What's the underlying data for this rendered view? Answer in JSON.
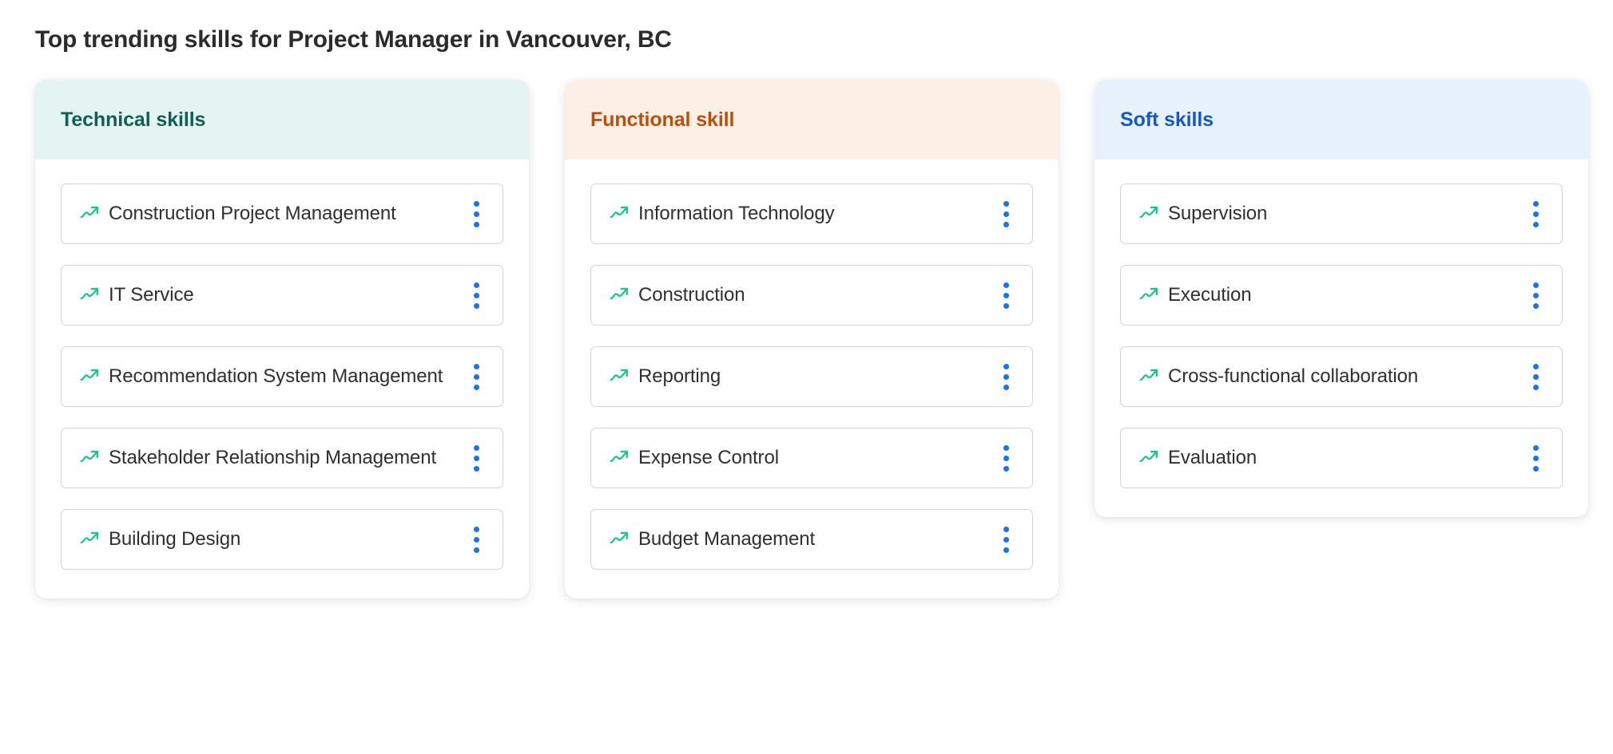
{
  "page": {
    "title": "Top trending skills for Project Manager in Vancouver, BC",
    "background": "#ffffff"
  },
  "icons": {
    "trend": "trending-up-icon",
    "menu": "kebab-menu-icon"
  },
  "colors": {
    "trend_icon": "#1ec28b",
    "kebab_dot": "#1a73e8",
    "item_border": "#d4d4d8",
    "item_text": "#2f2f2f",
    "title_text": "#2b2b2b"
  },
  "columns": [
    {
      "id": "technical-skills",
      "header": "Technical skills",
      "header_bg": "#e4f4f0",
      "header_color": "#0f5f58",
      "items": [
        {
          "label": "Construction Project Management"
        },
        {
          "label": "IT Service"
        },
        {
          "label": "Recommendation System Management"
        },
        {
          "label": "Stakeholder Relationship Management"
        },
        {
          "label": "Building Design"
        }
      ]
    },
    {
      "id": "functional-skill",
      "header": "Functional skill",
      "header_bg": "#fcf0e6",
      "header_color": "#b8500c",
      "items": [
        {
          "label": "Information Technology"
        },
        {
          "label": "Construction"
        },
        {
          "label": "Reporting"
        },
        {
          "label": "Expense Control"
        },
        {
          "label": "Budget Management"
        }
      ]
    },
    {
      "id": "soft-skills",
      "header": "Soft skills",
      "header_bg": "#e8f2fd",
      "header_color": "#1559c7",
      "items": [
        {
          "label": "Supervision"
        },
        {
          "label": "Execution"
        },
        {
          "label": "Cross-functional collaboration"
        },
        {
          "label": "Evaluation"
        }
      ]
    }
  ]
}
